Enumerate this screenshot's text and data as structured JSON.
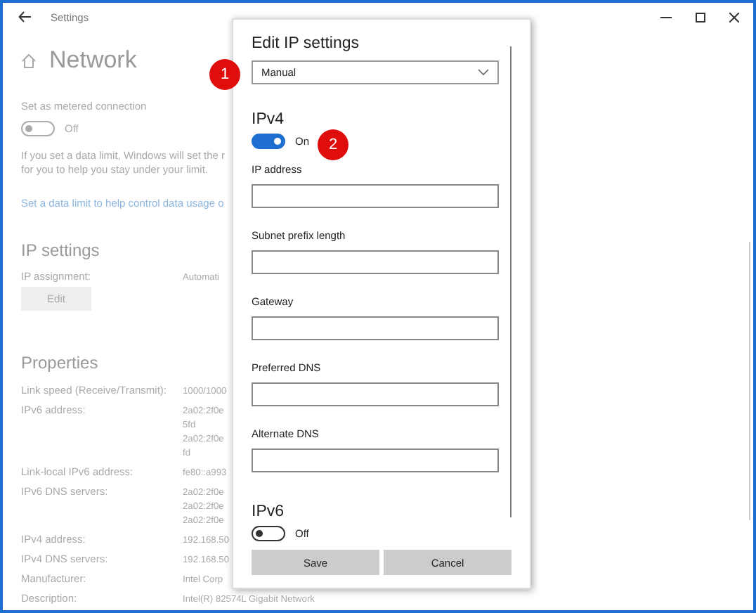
{
  "window": {
    "title": "Settings"
  },
  "page": {
    "title": "Network",
    "metered": {
      "label": "Set as metered connection",
      "on": false,
      "state_label": "Off"
    },
    "note_lines": [
      "If you set a data limit, Windows will set the r",
      "for you to help you stay under your limit."
    ],
    "link": "Set a data limit to help control data usage o",
    "ip_settings": {
      "title": "IP settings",
      "assignment_label": "IP assignment:",
      "assignment_value": "Automati",
      "edit_button": "Edit"
    },
    "properties": {
      "title": "Properties",
      "rows": [
        {
          "label": "Link speed (Receive/Transmit):",
          "values": [
            "1000/1000"
          ]
        },
        {
          "label": "IPv6 address:",
          "values": [
            "2a02:2f0e",
            "5fd",
            "2a02:2f0e",
            "fd"
          ]
        },
        {
          "label": "Link-local IPv6 address:",
          "values": [
            "fe80::a993"
          ]
        },
        {
          "label": "IPv6 DNS servers:",
          "values": [
            "2a02:2f0e",
            "2a02:2f0e",
            "2a02:2f0e"
          ]
        },
        {
          "label": "IPv4 address:",
          "values": [
            "192.168.50"
          ]
        },
        {
          "label": "IPv4 DNS servers:",
          "values": [
            "192.168.50"
          ]
        },
        {
          "label": "Manufacturer:",
          "values": [
            "Intel Corp"
          ]
        },
        {
          "label": "Description:",
          "values": [
            "Intel(R) 82574L Gigabit Network"
          ]
        }
      ]
    }
  },
  "dialog": {
    "title": "Edit IP settings",
    "mode": "Manual",
    "ipv4": {
      "title": "IPv4",
      "on": true,
      "state_label": "On"
    },
    "fields": [
      {
        "label": "IP address"
      },
      {
        "label": "Subnet prefix length"
      },
      {
        "label": "Gateway"
      },
      {
        "label": "Preferred DNS"
      },
      {
        "label": "Alternate DNS"
      }
    ],
    "ipv6": {
      "title": "IPv6",
      "on": false,
      "state_label": "Off"
    },
    "buttons": [
      "Save",
      "Cancel"
    ]
  },
  "callouts": [
    "1",
    "2"
  ]
}
